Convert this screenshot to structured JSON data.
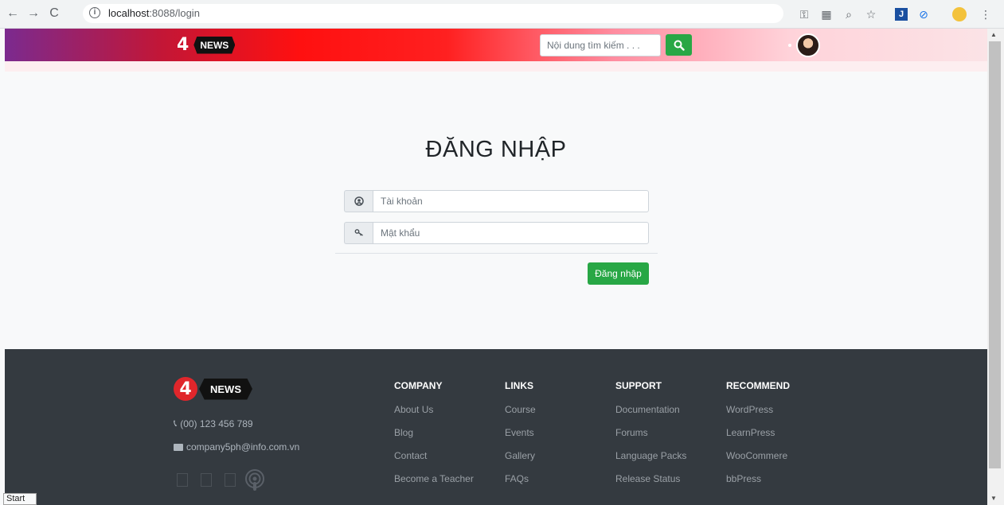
{
  "browser": {
    "url_host": "localhost",
    "url_path": ":8088/login",
    "icons": [
      "back-icon",
      "forward-icon",
      "reload-icon",
      "info-icon",
      "key-icon",
      "translate-icon",
      "zoom-icon",
      "star-icon",
      "extension-icon",
      "extension-icon",
      "profile-icon",
      "menu-icon"
    ]
  },
  "header": {
    "logo_number": "4",
    "logo_text": "NEWS",
    "search_placeholder": "Nội dung tìm kiếm . . .",
    "colors": {
      "gradient_start": "#7b2a8f",
      "gradient_mid": "#ff1010",
      "gradient_end": "#fbe3e6",
      "search_button": "#28a745"
    }
  },
  "login": {
    "title": "ĐĂNG NHẬP",
    "username_placeholder": "Tài khoản",
    "password_placeholder": "Mật khẩu",
    "submit_label": "Đăng nhập"
  },
  "footer": {
    "logo_number": "4",
    "logo_text": "NEWS",
    "phone": "(00) 123 456 789",
    "email": "company5ph@info.com.vn",
    "columns": [
      {
        "title": "COMPANY",
        "links": [
          "About Us",
          "Blog",
          "Contact",
          "Become a Teacher"
        ]
      },
      {
        "title": "LINKS",
        "links": [
          "Course",
          "Events",
          "Gallery",
          "FAQs"
        ]
      },
      {
        "title": "SUPPORT",
        "links": [
          "Documentation",
          "Forums",
          "Language Packs",
          "Release Status"
        ]
      },
      {
        "title": "RECOMMEND",
        "links": [
          "WordPress",
          "LearnPress",
          "WooCommere",
          "bbPress"
        ]
      }
    ],
    "background": "#343a40"
  },
  "status_bar": {
    "label": "Start"
  }
}
